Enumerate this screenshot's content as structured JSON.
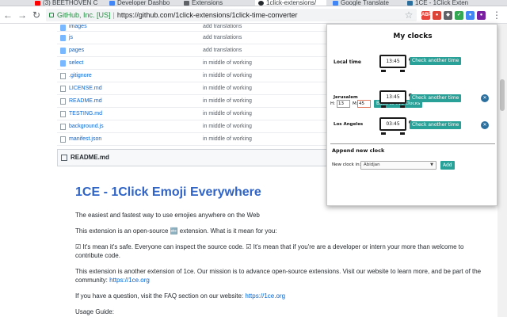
{
  "tabs": [
    {
      "title": "(3) BEETHOVEN C",
      "icon_color": "#ff0000",
      "icon": "youtube-icon"
    },
    {
      "title": "Developer Dashbo",
      "icon_color": "#4285f4",
      "icon": "chrome-store-icon"
    },
    {
      "title": "Extensions",
      "icon_color": "#5f6368",
      "icon": "puzzle-icon"
    },
    {
      "title": "1click-extensions/",
      "icon_color": "#24292e",
      "icon": "github-icon",
      "active": true
    },
    {
      "title": "Google Translate",
      "icon_color": "#4285f4",
      "icon": "translate-icon"
    },
    {
      "title": "1CE - 1Click Exten",
      "icon_color": "#2a6f9e",
      "icon": "1ce-icon"
    }
  ],
  "address": {
    "cert": "GitHub, Inc. [US]",
    "url": "https://github.com/1click-extensions/1click-time-converter"
  },
  "files": [
    {
      "name": "images",
      "type": "folder",
      "message": "add translations"
    },
    {
      "name": "js",
      "type": "folder",
      "message": "add translations"
    },
    {
      "name": "pages",
      "type": "folder",
      "message": "add translations"
    },
    {
      "name": "select",
      "type": "folder",
      "message": "in middle of working"
    },
    {
      "name": ".gitignore",
      "type": "file",
      "message": "in middle of working"
    },
    {
      "name": "LICENSE.md",
      "type": "file",
      "message": "in middle of working"
    },
    {
      "name": "README.md",
      "type": "file",
      "message": "in middle of working"
    },
    {
      "name": "TESTING.md",
      "type": "file",
      "message": "in middle of working"
    },
    {
      "name": "background.js",
      "type": "file",
      "message": "in middle of working"
    },
    {
      "name": "manifest.json",
      "type": "file",
      "message": "in middle of working"
    }
  ],
  "readme": {
    "header": "README.md",
    "title": "1CE - 1Click Emoji Everywhere",
    "p1": "The easiest and fastest way to use emojies anywhere on the Web",
    "p2": "This extension is an open-source 🔤 extension. What is it mean for you:",
    "p3": "☑ It's mean it's safe. Everyone can inspect the source code. ☑ It's mean that if you're are a developer or intern your more than welcome to contribute code.",
    "p4_text": "This extension is another extension of 1ce. Our mission is to advance open-source extensions. Visit our website to learn more, and be part of the community: ",
    "p4_link": "https://1ce.org",
    "p5_text": "If you have a question, visit the FAQ section on our website: ",
    "p5_link": "https://1ce.org",
    "p6": "Usage Guide:"
  },
  "popup": {
    "title": "My clocks",
    "local": {
      "name": "Local time",
      "time": "13:45",
      "button": "Check another time"
    },
    "hour_label": "H:",
    "hour_value": "13",
    "minute_label": "M:",
    "minute_value": "45",
    "back_button": "Back to live clocks",
    "clocks": [
      {
        "name": "Jerusalem",
        "time": "13:45",
        "button": "Check another time"
      },
      {
        "name": "Los Angeles",
        "time": "03:45",
        "button": "Check another time"
      }
    ],
    "close_glyph": "✕",
    "append_title": "Append new clock",
    "new_clock_label": "New clock in:",
    "select_value": "Abidjan",
    "add_button": "Add"
  },
  "colors": {
    "accent": "#2aa198",
    "link": "#0366d6",
    "title": "#2f64c6"
  }
}
